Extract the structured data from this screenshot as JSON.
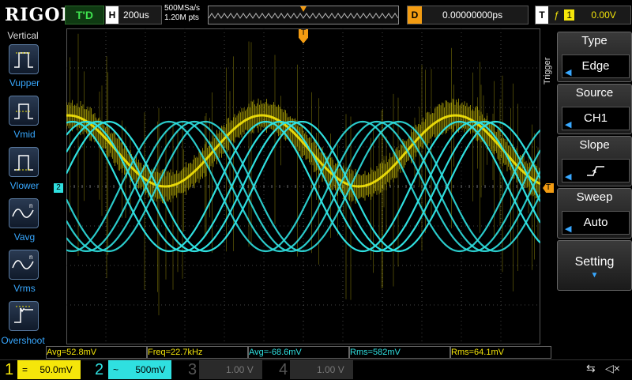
{
  "topbar": {
    "logo": "RIGOL",
    "trigger_status": "T'D",
    "timebase_label": "H",
    "timebase_value": "200us",
    "sample_rate": "500MSa/s",
    "memory_depth": "1.20M pts",
    "delay_label": "D",
    "delay_value": "0.00000000ps",
    "trigger_label": "T",
    "trigger_channel": "1",
    "trigger_level": "0.00V"
  },
  "left_menu": {
    "title": "Vertical",
    "items": [
      {
        "label": "Vupper",
        "icon": "vupper-icon"
      },
      {
        "label": "Vmid",
        "icon": "vmid-icon"
      },
      {
        "label": "Vlower",
        "icon": "vlower-icon"
      },
      {
        "label": "Vavg",
        "icon": "vavg-icon"
      },
      {
        "label": "Vrms",
        "icon": "vrms-icon"
      },
      {
        "label": "Overshoot",
        "icon": "overshoot-icon"
      }
    ]
  },
  "right_menu": {
    "vertical_title": "Trigger",
    "type": {
      "label": "Type",
      "value": "Edge"
    },
    "source": {
      "label": "Source",
      "value": "CH1"
    },
    "slope": {
      "label": "Slope"
    },
    "sweep": {
      "label": "Sweep",
      "value": "Auto"
    },
    "setting": {
      "label": "Setting"
    }
  },
  "markers": {
    "ch2_marker": "2",
    "trigger_top": "T",
    "trigger_right": "T"
  },
  "measurements": [
    {
      "text": "Avg=52.8mV",
      "color": "#f5e60a"
    },
    {
      "text": "Freq=22.7kHz",
      "color": "#f5e60a"
    },
    {
      "text": "Avg=-68.6mV",
      "color": "#2fe0e0"
    },
    {
      "text": "Rms=582mV",
      "color": "#2fe0e0"
    },
    {
      "text": "Rms=64.1mV",
      "color": "#f5e60a"
    }
  ],
  "channels": [
    {
      "num": "1",
      "coupling": "=",
      "scale": "50.0mV",
      "color": "#f5e60a"
    },
    {
      "num": "2",
      "coupling": "~",
      "scale": "500mV",
      "color": "#2fe0e0"
    },
    {
      "num": "3",
      "scale": "1.00 V",
      "color": "#777777"
    },
    {
      "num": "4",
      "scale": "1.00 V",
      "color": "#777777"
    }
  ],
  "colors": {
    "ch1": "#f5e60a",
    "ch2": "#2fe0e0",
    "trigger": "#f39c12",
    "accent": "#38a8ff"
  }
}
